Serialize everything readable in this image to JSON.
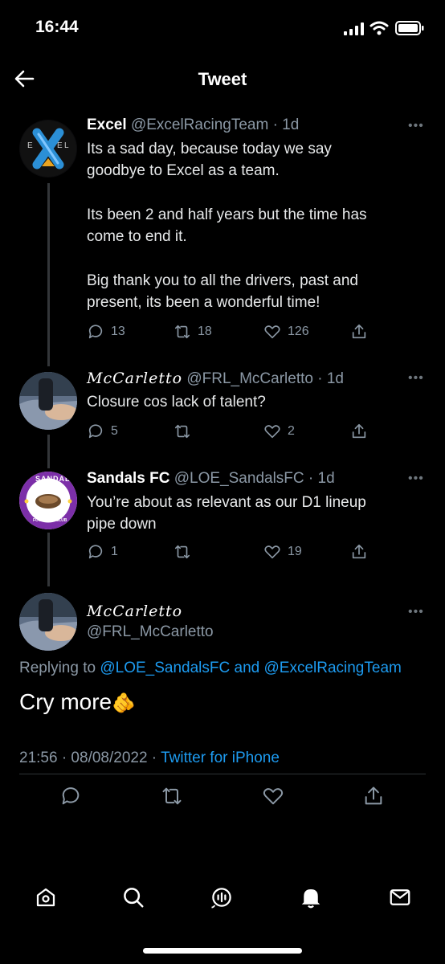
{
  "status_bar": {
    "time": "16:44"
  },
  "header": {
    "title": "Tweet"
  },
  "thread": [
    {
      "name": "Excel",
      "handle": "@ExcelRacingTeam",
      "age": "· 1d",
      "text_lines": [
        "Its a sad day, because today we say",
        "goodbye to Excel as a team.",
        "",
        "Its been 2 and half years but the time has",
        "come to end it.",
        "",
        "Big thank you to all the drivers, past and",
        "present, its been a wonderful time!"
      ],
      "replies": "13",
      "retweets": "18",
      "likes": "126",
      "avatar_letters": [
        "E",
        "X",
        "E",
        "L"
      ]
    },
    {
      "name": "McCarletto",
      "handle": "@FRL_McCarletto",
      "age": "· 1d",
      "text_lines": [
        "Closure cos lack of talent?"
      ],
      "replies": "5",
      "retweets": "",
      "likes": "2"
    },
    {
      "name": "Sandals FC",
      "handle": "@LOE_SandalsFC",
      "age": "· 1d",
      "text_lines": [
        "You’re about as relevant as our D1 lineup",
        "pipe down"
      ],
      "replies": "1",
      "retweets": "",
      "likes": "19",
      "avatar_top": "SANDALS",
      "avatar_bottom": "FOOTBALL CLUB"
    }
  ],
  "main_tweet": {
    "name": "McCarletto",
    "handle": "@FRL_McCarletto",
    "replying_prefix": "Replying to",
    "replying_to_1": "@LOE_SandalsFC",
    "replying_and": "and",
    "replying_to_2": "@ExcelRacingTeam",
    "text": "Cry more",
    "emoji": "🫵",
    "timestamp": "21:56 · 08/08/2022 ·",
    "source": "Twitter for iPhone"
  },
  "tabbar": {
    "icons": [
      "home-icon",
      "search-icon",
      "spaces-icon",
      "notifications-icon",
      "messages-icon"
    ]
  },
  "colors": {
    "link": "#1d9bf0",
    "background": "#000000",
    "muted": "#8b98a5"
  }
}
